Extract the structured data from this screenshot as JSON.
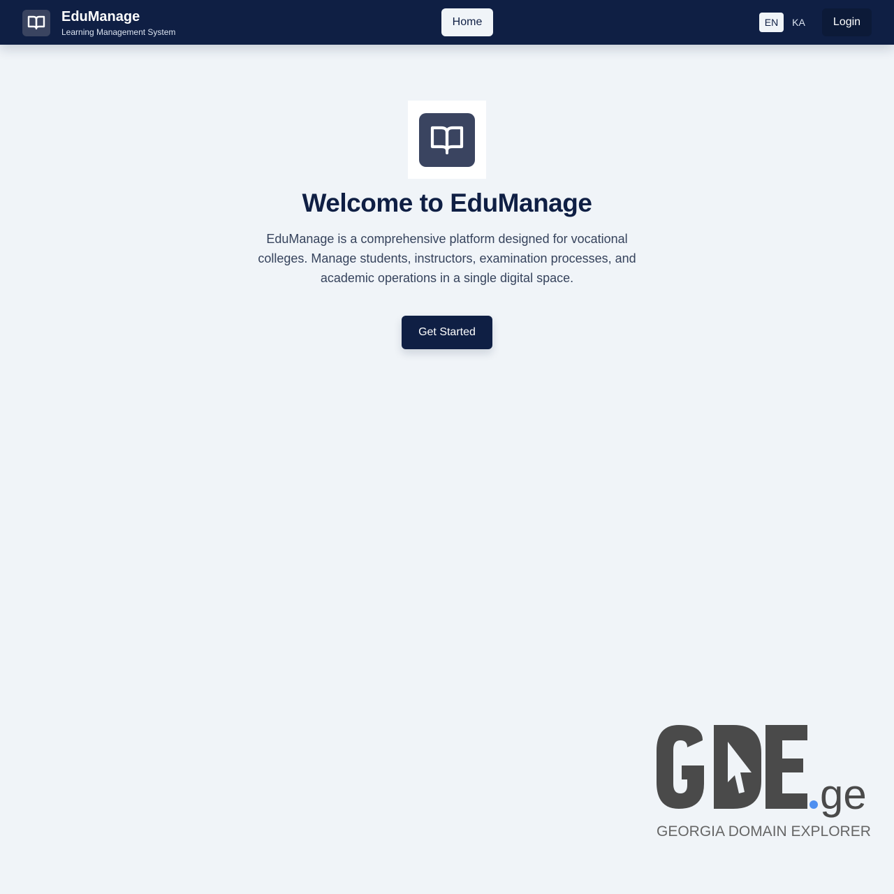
{
  "header": {
    "brand_name": "EduManage",
    "brand_subtitle": "Learning Management System",
    "brand_icon": "book-open-icon",
    "nav_home": "Home",
    "languages": [
      "EN",
      "KA"
    ],
    "active_language": "EN",
    "login_label": "Login"
  },
  "hero": {
    "logo_icon": "book-open-icon",
    "title": "Welcome to EduManage",
    "description": "EduManage is a comprehensive platform designed for vocational colleges. Manage students, instructors, examination processes, and academic operations in a single digital space.",
    "cta_label": "Get Started"
  },
  "watermark": {
    "logo_text": "GDE.ge",
    "caption": "GEORGIA DOMAIN EXPLORER"
  },
  "colors": {
    "navy": "#0f1f44",
    "background": "#f0f4f8",
    "icon_tile": "#3a4460",
    "watermark_gray": "#4a4a4a",
    "watermark_dot": "#4e8ff0"
  }
}
